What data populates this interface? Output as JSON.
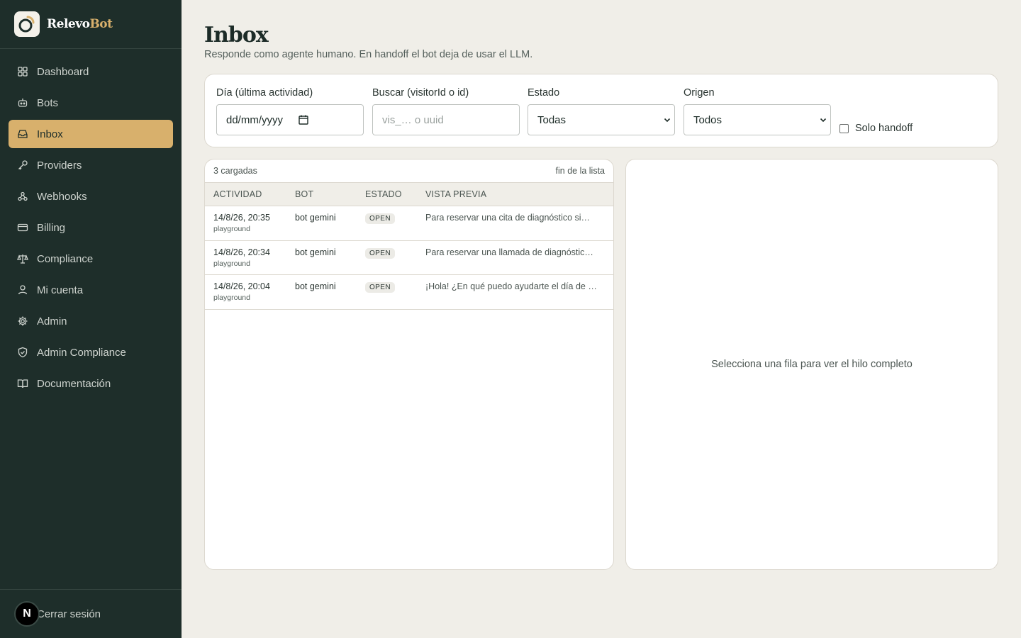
{
  "brand": {
    "name_main": "Relevo",
    "name_accent": "Bot"
  },
  "sidebar": {
    "items": [
      {
        "label": "Dashboard",
        "icon": "dashboard-grid-icon"
      },
      {
        "label": "Bots",
        "icon": "bot-icon"
      },
      {
        "label": "Inbox",
        "icon": "inbox-icon",
        "active": true
      },
      {
        "label": "Providers",
        "icon": "key-icon"
      },
      {
        "label": "Webhooks",
        "icon": "webhook-icon"
      },
      {
        "label": "Billing",
        "icon": "credit-card-icon"
      },
      {
        "label": "Compliance",
        "icon": "scale-icon"
      },
      {
        "label": "Mi cuenta",
        "icon": "user-icon"
      },
      {
        "label": "Admin",
        "icon": "gear-icon"
      },
      {
        "label": "Admin Compliance",
        "icon": "shield-icon"
      },
      {
        "label": "Documentación",
        "icon": "book-icon"
      }
    ],
    "avatar_letter": "N",
    "logout_label": "Cerrar sesión"
  },
  "page": {
    "title": "Inbox",
    "subtitle": "Responde como agente humano. En handoff el bot deja de usar el LLM."
  },
  "filters": {
    "day_label": "Día (última actividad)",
    "day_value": "dd/mm/yyyy",
    "search_label": "Buscar (visitorId o id)",
    "search_placeholder": "vis_… o uuid",
    "estado_label": "Estado",
    "estado_value": "Todas",
    "origen_label": "Origen",
    "origen_value": "Todos",
    "handoff_label": "Solo handoff",
    "handoff_checked": false
  },
  "list": {
    "loaded_count": "3 cargadas",
    "end_label": "fin de la lista",
    "headers": [
      "ACTIVIDAD",
      "BOT",
      "ESTADO",
      "VISTA PREVIA"
    ],
    "rows": [
      {
        "date": "14/8/26, 20:35",
        "origin": "playground",
        "bot": "bot gemini",
        "status": "OPEN",
        "preview": "Para reservar una cita de diagnóstico si…"
      },
      {
        "date": "14/8/26, 20:34",
        "origin": "playground",
        "bot": "bot gemini",
        "status": "OPEN",
        "preview": "Para reservar una llamada de diagnóstic…"
      },
      {
        "date": "14/8/26, 20:04",
        "origin": "playground",
        "bot": "bot gemini",
        "status": "OPEN",
        "preview": "¡Hola! ¿En qué puedo ayudarte el día de …"
      }
    ]
  },
  "detail": {
    "empty_message": "Selecciona una fila para ver el hilo completo"
  },
  "colors": {
    "sidebar_bg": "#1e2e2a",
    "accent": "#d8b06c",
    "page_bg": "#f0eee8"
  }
}
